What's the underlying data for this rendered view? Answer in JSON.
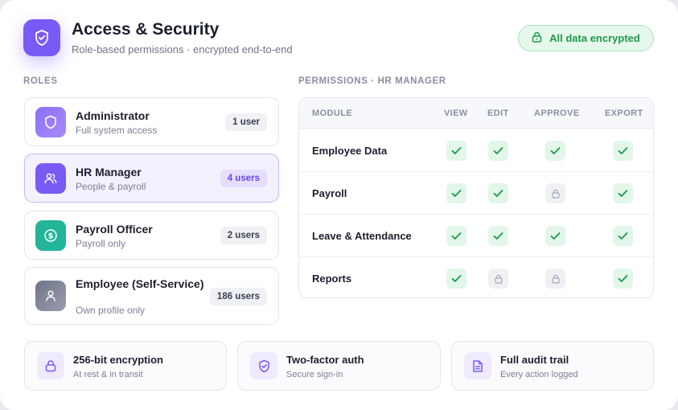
{
  "header": {
    "title": "Access & Security",
    "subtitle": "Role-based permissions · encrypted end-to-end",
    "encryption_badge": "All data encrypted",
    "brand_icon": "shield-check-icon"
  },
  "roles": {
    "section_label": "ROLES",
    "items": [
      {
        "name": "Administrator",
        "desc": "Full system access",
        "count": "1 user",
        "icon": "shield-icon",
        "color": "#7a5af5"
      },
      {
        "name": "HR Manager",
        "desc": "People & payroll",
        "count": "4 users",
        "icon": "users-icon",
        "color": "#7a5af5",
        "active": true
      },
      {
        "name": "Payroll Officer",
        "desc": "Payroll only",
        "count": "2 users",
        "icon": "dollar-icon",
        "color": "#22b59a"
      },
      {
        "name": "Employee (Self-Service)",
        "desc": "Own profile only",
        "count": "186 users",
        "icon": "user-icon",
        "color": "#7d8296"
      }
    ]
  },
  "permissions": {
    "section_label": "PERMISSIONS · HR MANAGER",
    "columns": [
      "MODULE",
      "VIEW",
      "EDIT",
      "APPROVE",
      "EXPORT"
    ],
    "rows": [
      {
        "module": "Employee Data",
        "view": true,
        "edit": true,
        "approve": true,
        "export": true
      },
      {
        "module": "Payroll",
        "view": true,
        "edit": true,
        "approve": false,
        "export": true
      },
      {
        "module": "Leave & Attendance",
        "view": true,
        "edit": true,
        "approve": true,
        "export": true
      },
      {
        "module": "Reports",
        "view": true,
        "edit": false,
        "approve": false,
        "export": true
      }
    ]
  },
  "features": [
    {
      "title": "256-bit encryption",
      "desc": "At rest & in transit",
      "icon": "lock-icon"
    },
    {
      "title": "Two-factor auth",
      "desc": "Secure sign-in",
      "icon": "shield-check-icon"
    },
    {
      "title": "Full audit trail",
      "desc": "Every action logged",
      "icon": "document-icon"
    }
  ],
  "colors": {
    "accent": "#7a5af5",
    "success": "#1f9a4a",
    "teal": "#22b59a"
  }
}
